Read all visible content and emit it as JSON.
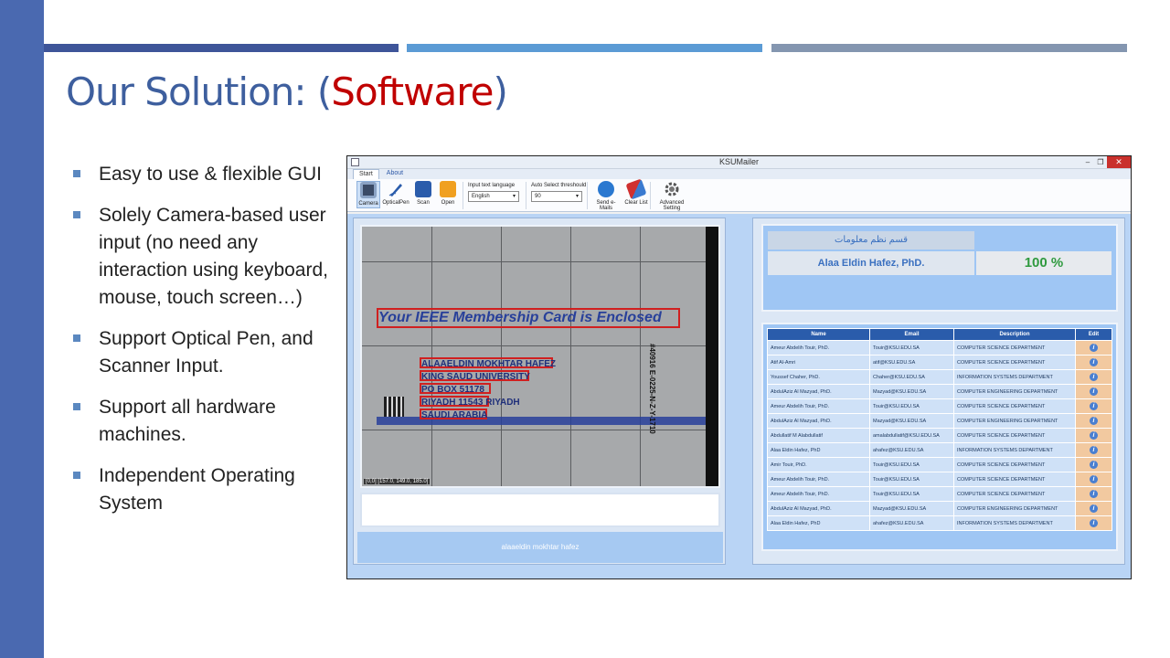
{
  "slide": {
    "title_prefix": "Our Solution: (",
    "title_accent": "Software",
    "title_suffix": ")",
    "bullets": [
      "Easy to use & flexible GUI",
      "Solely Camera-based user input (no need any interaction using keyboard, mouse, touch screen…)",
      "Support Optical Pen, and Scanner Input.",
      "Support all hardware machines.",
      "Independent Operating System"
    ]
  },
  "app": {
    "title": "KSUMailer",
    "window_buttons": {
      "minimize": "–",
      "maximize": "❐",
      "close": "✕"
    },
    "tabs": [
      "Start",
      "About"
    ],
    "toolbar": {
      "camera": "Camera",
      "optical_pen": "OpticalPen",
      "scan": "Scan",
      "open": "Open",
      "language_label": "Input text language",
      "language_value": "English",
      "threshold_label": "Auto Select threshould",
      "threshold_value": "90",
      "send_emails": "Send e-Mails",
      "clear_list": "Clear List",
      "advanced_setting": "Advanced Setting"
    },
    "camera": {
      "ieee_text": "Your IEEE Membership Card is Enclosed",
      "address_lines": [
        "ALAAELDIN MOKHTAR HAFEZ",
        "KING SAUD UNIVERSITY",
        "PO BOX 51178",
        "RIYADH 11543 RIYADH",
        "SAUDI ARABIA"
      ],
      "vertical_text": "#40916  E-0225-N-Z-Y-1710",
      "coords": "[0,0] [157.0, 149.0, 185.0]"
    },
    "detected_name": "alaaeldin mokhtar hafez",
    "result": {
      "arabic_dept": "قسم نظم معلومات",
      "name": "Alaa Eldin Hafez, PhD.",
      "match": "100 %"
    },
    "table": {
      "headers": [
        "Name",
        "Email",
        "Description",
        "Edit"
      ],
      "rows": [
        [
          "Ameur Abdelih Touir, PhD.",
          "Touir@KSU.EDU.SA",
          "COMPUTER SCIENCE DEPARTMENT"
        ],
        [
          "Atif Al-Amri",
          "atif@KSU.EDU.SA",
          "COMPUTER SCIENCE DEPARTMENT"
        ],
        [
          "Youssef Chaher, PhD.",
          "Chaher@KSU.EDU.SA",
          "INFORMATION SYSTEMS DEPARTMENT"
        ],
        [
          "AbdulAziz Al Mazyad, PhD.",
          "Mazyad@KSU.EDU.SA",
          "COMPUTER ENGINEERING DEPARTMENT"
        ],
        [
          "Ameur Abdelih Touir, PhD.",
          "Touir@KSU.EDU.SA",
          "COMPUTER SCIENCE DEPARTMENT"
        ],
        [
          "AbdulAziz Al Mazyad, PhD.",
          "Mazyad@KSU.EDU.SA",
          "COMPUTER ENGINEERING DEPARTMENT"
        ],
        [
          "Abdullatif M Alabdullatif",
          "amalabdullatif@KSU.EDU.SA",
          "COMPUTER SCIENCE DEPARTMENT"
        ],
        [
          "Alaa Eldin Hafez, PhD",
          "ahafez@KSU.EDU.SA",
          "INFORMATION SYSTEMS DEPARTMENT"
        ],
        [
          "Amir Touir, PhD.",
          "Touir@KSU.EDU.SA",
          "COMPUTER SCIENCE DEPARTMENT"
        ],
        [
          "Ameur Abdelih Touir, PhD.",
          "Touir@KSU.EDU.SA",
          "COMPUTER SCIENCE DEPARTMENT"
        ],
        [
          "Ameur Abdelih Touir, PhD.",
          "Touir@KSU.EDU.SA",
          "COMPUTER SCIENCE DEPARTMENT"
        ],
        [
          "AbdulAziz Al Mazyad, PhD.",
          "Mazyad@KSU.EDU.SA",
          "COMPUTER ENGINEERING DEPARTMENT"
        ],
        [
          "Alaa Eldin Hafez, PhD",
          "ahafez@KSU.EDU.SA",
          "INFORMATION SYSTEMS DEPARTMENT"
        ]
      ],
      "edit_icon": "info-icon"
    },
    "colors": {
      "accent": "#c00000",
      "title_blue": "#3e5f9e",
      "header_blue": "#2a5cab",
      "match_green": "#2f9a3f",
      "bounding_box": "#d02020"
    }
  }
}
